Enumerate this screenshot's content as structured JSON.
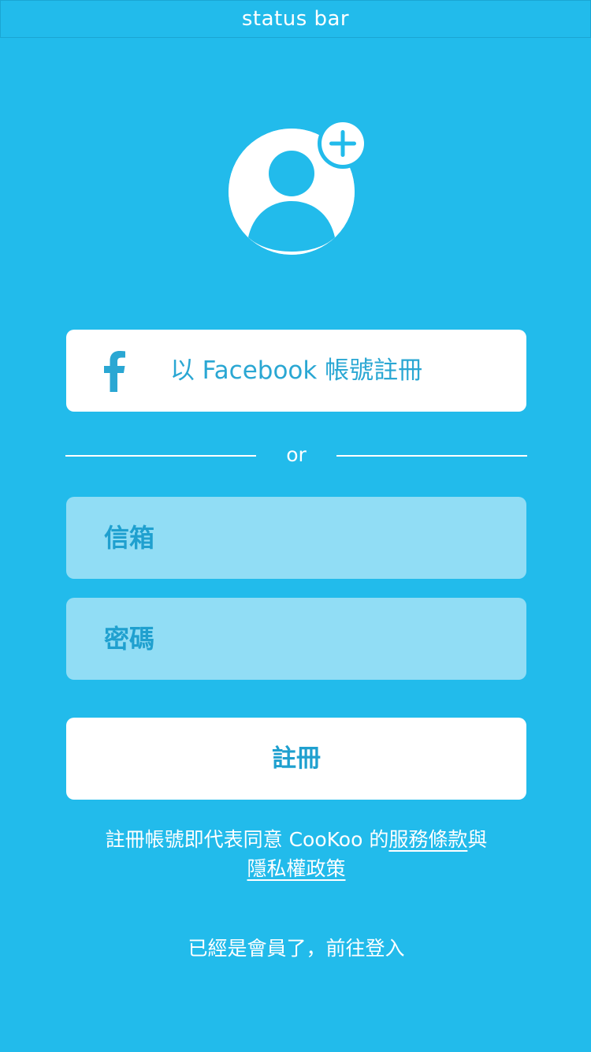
{
  "status_bar": {
    "label": "status bar"
  },
  "avatar": {
    "icon": "user-avatar-icon",
    "badge_icon": "plus-icon"
  },
  "facebook_button": {
    "icon": "facebook-icon",
    "label": "以 Facebook 帳號註冊"
  },
  "divider": {
    "label": "or"
  },
  "form": {
    "email_placeholder": "信箱",
    "email_value": "",
    "password_placeholder": "密碼",
    "password_value": ""
  },
  "register_button": {
    "label": "註冊"
  },
  "terms": {
    "prefix": "註冊帳號即代表同意 CooKoo 的",
    "terms_link": "服務條款",
    "conjunction": "與",
    "privacy_link": "隱私權政策"
  },
  "login_link": {
    "label": "已經是會員了，前往登入"
  },
  "colors": {
    "background": "#22BBEB",
    "field_background": "#91DDF5",
    "accent_text": "#1FA0CF",
    "white": "#FFFFFF"
  }
}
